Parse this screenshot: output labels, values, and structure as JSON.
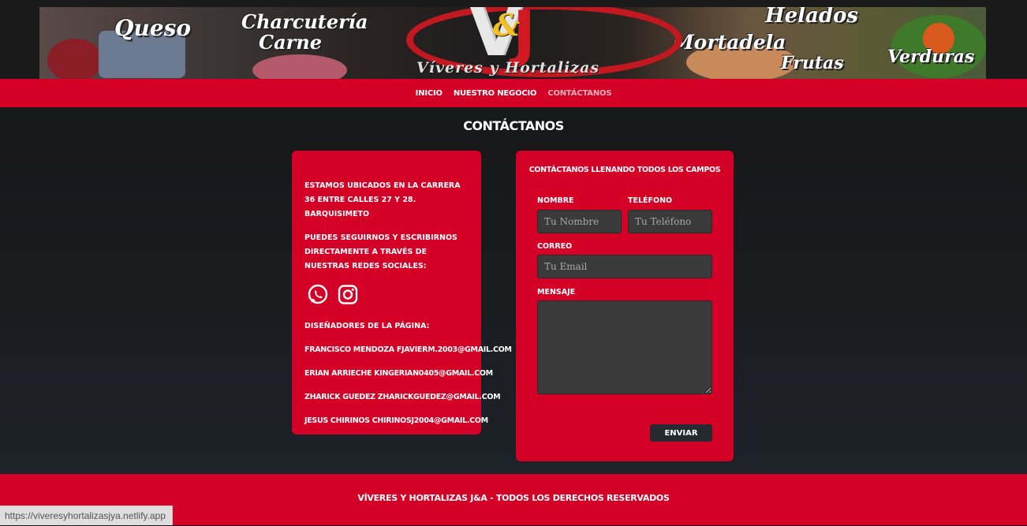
{
  "banner": {
    "words": [
      "Queso",
      "Charcutería",
      "Carne",
      "Helados",
      "Mortadela",
      "Frutas",
      "Verduras"
    ],
    "logo_letters": {
      "v": "V",
      "amp": "&",
      "j": "J"
    },
    "logo_subtitle": "Víveres y Hortalizas"
  },
  "nav": {
    "items": [
      {
        "label": "INICIO"
      },
      {
        "label": "NUESTRO NEGOCIO"
      },
      {
        "label": "CONTÁCTANOS"
      }
    ]
  },
  "section_title": "CONTÁCTANOS",
  "info": {
    "location": "Estamos ubicados en la carrera 36 entre calles 27 y 28. Barquisimeto",
    "social_text": "Puedes seguirnos y escribirnos directamente a través de nuestras redes sociales:",
    "social_icons": [
      "whatsapp-icon",
      "instagram-icon"
    ],
    "designers_title": "Diseñadores de la página:",
    "designers": [
      "Francisco Mendoza fjavierm.2003@gmail.com",
      "Erian Arrieche kingerian0405@gmail.com",
      "Zharick Guedez zharickguedez@gmail.com",
      "Jesus Chirinos chirinosj2004@gmail.com"
    ]
  },
  "form": {
    "title": "Contáctanos llenando todos los campos",
    "name_label": "Nombre",
    "name_placeholder": "Tu Nombre",
    "phone_label": "Teléfono",
    "phone_placeholder": "Tu Teléfono",
    "email_label": "Correo",
    "email_placeholder": "Tu Email",
    "message_label": "Mensaje",
    "message_placeholder": "",
    "submit_label": "Enviar"
  },
  "footer": {
    "text": "Víveres y Hortalizas J&A - Todos los derechos reservados"
  },
  "status_bar": {
    "url": "https://viveresyhortalizasjya.netlify.app"
  },
  "colors": {
    "brand_red": "#d50026",
    "background_dark": "#151515",
    "field_bg": "#3a3a3a",
    "button_dark": "#262a30"
  }
}
